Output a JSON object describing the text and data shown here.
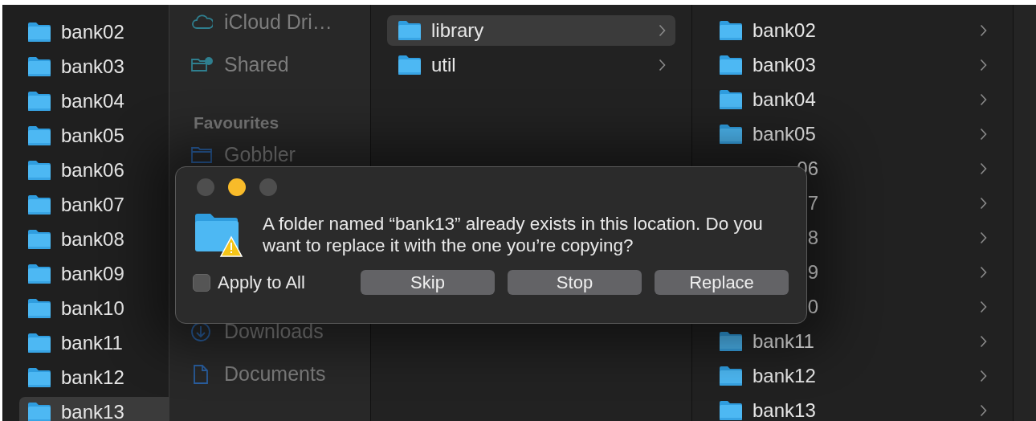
{
  "left_column": {
    "items": [
      {
        "name": "bank02",
        "selected": false
      },
      {
        "name": "bank03",
        "selected": false
      },
      {
        "name": "bank04",
        "selected": false
      },
      {
        "name": "bank05",
        "selected": false
      },
      {
        "name": "bank06",
        "selected": false
      },
      {
        "name": "bank07",
        "selected": false
      },
      {
        "name": "bank08",
        "selected": false
      },
      {
        "name": "bank09",
        "selected": false
      },
      {
        "name": "bank10",
        "selected": false
      },
      {
        "name": "bank11",
        "selected": false
      },
      {
        "name": "bank12",
        "selected": false
      },
      {
        "name": "bank13",
        "selected": true
      }
    ]
  },
  "sidebar": {
    "sections": [
      {
        "items": [
          {
            "label": "iCloud Dri…",
            "kind": "cloud"
          },
          {
            "label": "Shared",
            "kind": "shared"
          }
        ]
      },
      {
        "header": "Favourites",
        "items": [
          {
            "label": "Gobbler",
            "kind": "folder"
          },
          {
            "label": "Downloads",
            "kind": "download"
          },
          {
            "label": "Documents",
            "kind": "document"
          }
        ]
      }
    ]
  },
  "middle_column": {
    "items": [
      {
        "name": "library",
        "selected": true
      },
      {
        "name": "util",
        "selected": false
      }
    ]
  },
  "right_column": {
    "items": [
      {
        "name": "bank02",
        "kind": "folder"
      },
      {
        "name": "bank03",
        "kind": "folder"
      },
      {
        "name": "bank04",
        "kind": "folder"
      },
      {
        "name": "bank05",
        "kind": "folder"
      },
      {
        "name": "06",
        "kind": "clipped"
      },
      {
        "name": "7",
        "kind": "clipped"
      },
      {
        "name": "8",
        "kind": "clipped"
      },
      {
        "name": "9",
        "kind": "clipped"
      },
      {
        "name": "0",
        "kind": "clipped"
      },
      {
        "name": "bank11",
        "kind": "folder"
      },
      {
        "name": "bank12",
        "kind": "folder"
      },
      {
        "name": "bank13",
        "kind": "folder"
      }
    ]
  },
  "dialog": {
    "window_controls": [
      {
        "color": "#4e4e4e"
      },
      {
        "color": "#f8bb2a"
      },
      {
        "color": "#4e4e4e"
      }
    ],
    "message": "A folder named “bank13” already exists in this location. Do you want to replace it with the one you’re copying?",
    "apply_to_all": {
      "label": "Apply to All",
      "checked": false
    },
    "buttons": [
      "Skip",
      "Stop",
      "Replace"
    ]
  }
}
